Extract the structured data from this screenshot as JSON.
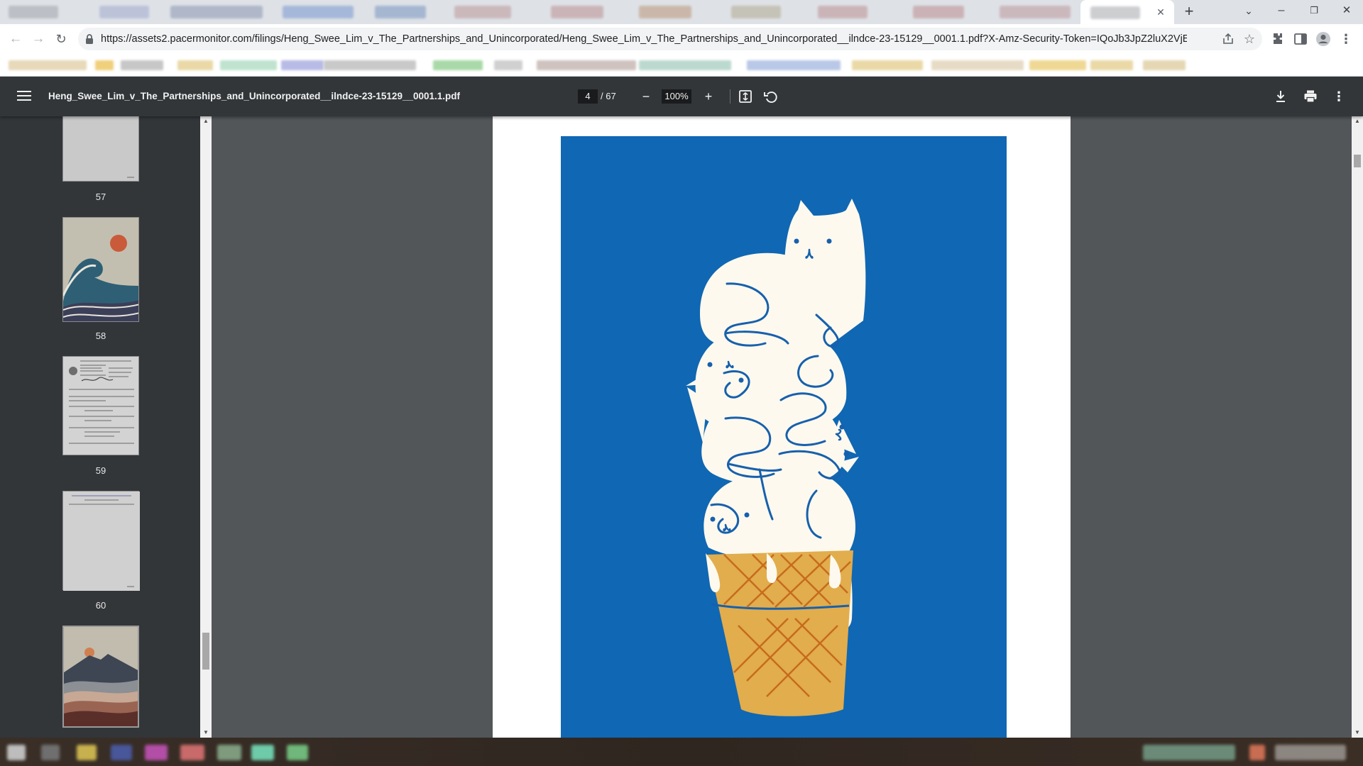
{
  "browser": {
    "url": "https://assets2.pacermonitor.com/filings/Heng_Swee_Lim_v_The_Partnerships_and_Unincorporated/Heng_Swee_Lim_v_The_Partnerships_and_Unincorporated__ilndce-23-15129__0001.1.pdf?X-Amz-Security-Token=IQoJb3JpZ2luX2VjE...",
    "new_tab_label": "+",
    "icons": {
      "back": "arrow-left-icon",
      "forward": "arrow-right-icon",
      "reload": "reload-icon",
      "lock": "lock-icon",
      "share": "share-icon",
      "bookmark": "star-icon",
      "extensions": "puzzle-icon",
      "side_panel": "side-panel-icon",
      "profile": "profile-icon",
      "menu": "kebab-menu-icon"
    }
  },
  "pdf": {
    "title": "Heng_Swee_Lim_v_The_Partnerships_and_Unincorporated__ilndce-23-15129__0001.1.pdf",
    "current_page": "4",
    "total_pages": "/ 67",
    "zoom": "100%",
    "zoom_out_label": "−",
    "zoom_in_label": "+",
    "thumbnails": [
      {
        "label": "57"
      },
      {
        "label": "58"
      },
      {
        "label": "59"
      },
      {
        "label": "60"
      },
      {
        "label": ""
      }
    ]
  },
  "colors": {
    "art_background": "#1067b3",
    "ice_cream": "#fdf9ee",
    "cone": "#e2ad4c",
    "cone_lines": "#c66b1d",
    "line_work": "#1760ad"
  }
}
